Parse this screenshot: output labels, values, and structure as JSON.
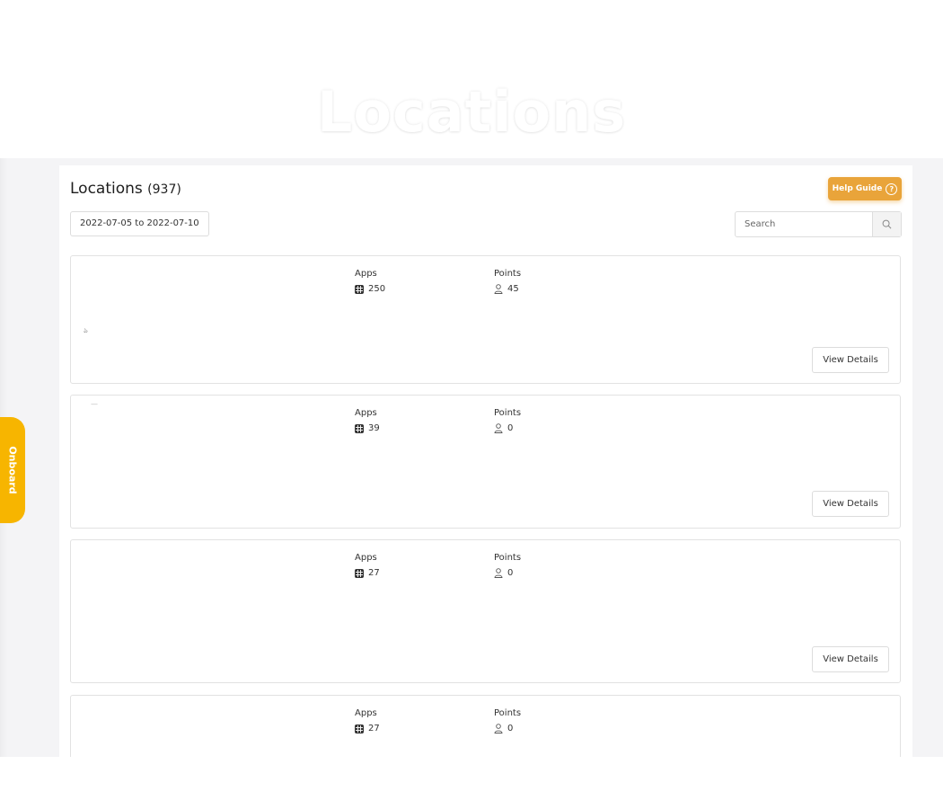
{
  "hero": {
    "title": "Locations"
  },
  "header": {
    "title": "Locations",
    "count": "(937)",
    "help_label": "Help Guide",
    "help_icon": "?"
  },
  "filters": {
    "date_range": "2022-07-05 to 2022-07-10",
    "search_placeholder": "Search"
  },
  "cards": [
    {
      "apps_label": "Apps",
      "apps_value": "250",
      "points_label": "Points",
      "points_value": "45",
      "view_label": "View Details",
      "glyph": "ঌ"
    },
    {
      "apps_label": "Apps",
      "apps_value": "39",
      "points_label": "Points",
      "points_value": "0",
      "view_label": "View Details",
      "glyph": "—"
    },
    {
      "apps_label": "Apps",
      "apps_value": "27",
      "points_label": "Points",
      "points_value": "0",
      "view_label": "View Details"
    },
    {
      "apps_label": "Apps",
      "apps_value": "27",
      "points_label": "Points",
      "points_value": "0"
    }
  ],
  "onboard": {
    "label": "Onboard"
  },
  "colors": {
    "accent": "#e9a43a",
    "onboard": "#f7b500"
  },
  "icons": {
    "apps": "grid-icon",
    "points": "user-icon",
    "search": "search-icon"
  }
}
